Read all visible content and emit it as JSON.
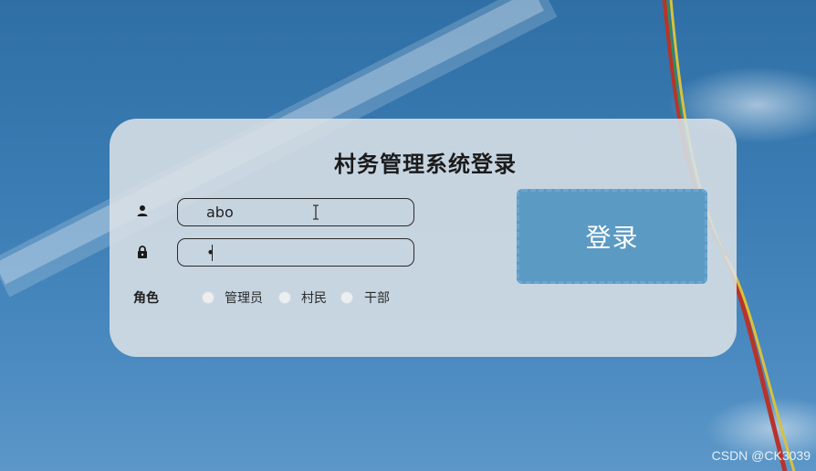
{
  "login": {
    "title": "村务管理系统登录",
    "username_value": "abo",
    "password_value": "•",
    "role_label": "角色",
    "roles": [
      "管理员",
      "村民",
      "干部"
    ],
    "submit_label": "登录"
  },
  "watermark": "CSDN @CK3039",
  "colors": {
    "button": "#5b9ac3",
    "card": "#dae0e6",
    "sky": "#3a7cb3"
  },
  "icons": {
    "username": "user-icon",
    "password": "lock-icon"
  }
}
